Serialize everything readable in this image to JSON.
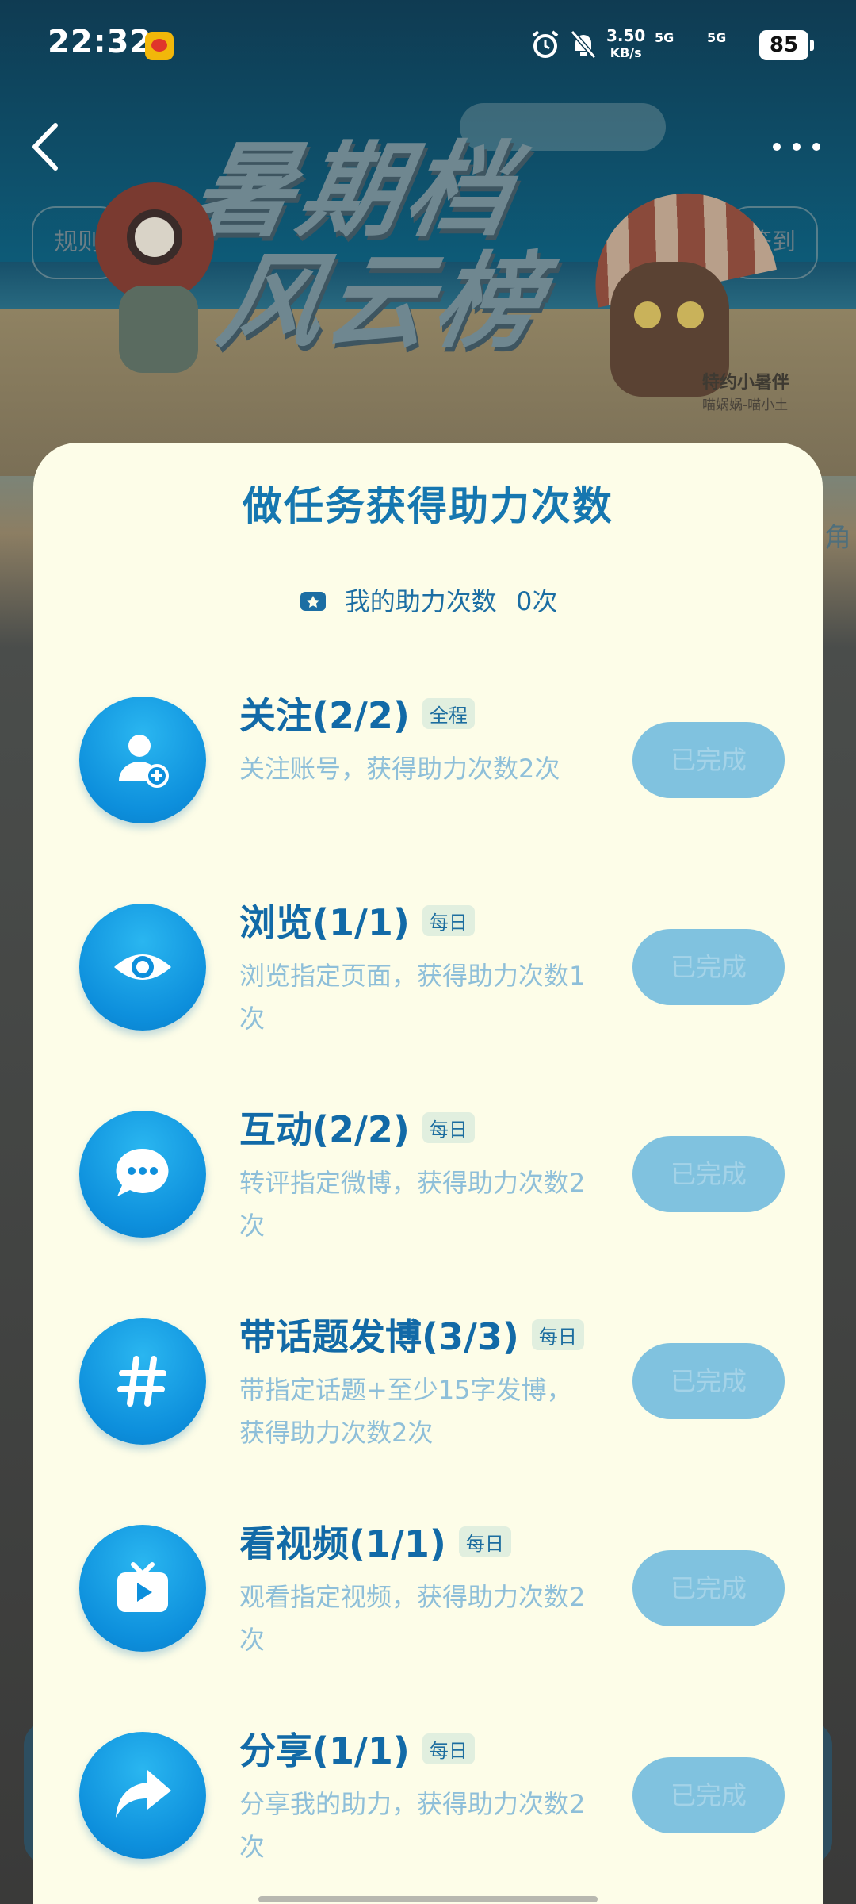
{
  "status_bar": {
    "time": "22:32",
    "net_speed": "3.50",
    "net_unit": "KB/s",
    "signal_1": "5G",
    "signal_2": "5G",
    "battery": "85"
  },
  "background": {
    "title_line1": "暑期档",
    "title_line2": "风云榜",
    "rules_label": "规则",
    "checkin_label": "签到",
    "partner_title": "特约小暑伴",
    "partner_names": "喵娲娲-喵小土",
    "side_char": "角"
  },
  "sheet": {
    "title": "做任务获得助力次数",
    "my_count_label": "我的助力次数",
    "my_count_value": "0次"
  },
  "tasks": [
    {
      "name": "关注(2/2)",
      "tag": "全程",
      "desc": "关注账号，获得助力次数2次",
      "button": "已完成",
      "icon": "follow-user-icon"
    },
    {
      "name": "浏览(1/1)",
      "tag": "每日",
      "desc": "浏览指定页面，获得助力次数1次",
      "button": "已完成",
      "icon": "eye-icon"
    },
    {
      "name": "互动(2/2)",
      "tag": "每日",
      "desc": "转评指定微博，获得助力次数2次",
      "button": "已完成",
      "icon": "chat-bubble-icon"
    },
    {
      "name": "带话题发博(3/3)",
      "tag": "每日",
      "desc": "带指定话题+至少15字发博，获得助力次数2次",
      "button": "已完成",
      "icon": "hashtag-icon"
    },
    {
      "name": "看视频(1/1)",
      "tag": "每日",
      "desc": "观看指定视频，获得助力次数2次",
      "button": "已完成",
      "icon": "video-tv-icon"
    },
    {
      "name": "分享(1/1)",
      "tag": "每日",
      "desc": "分享我的助力，获得助力次数2次",
      "button": "已完成",
      "icon": "share-arrow-icon"
    }
  ],
  "colors": {
    "sheet_bg": "#fdfde8",
    "title": "#1677b0",
    "icon_circle": "#0d8fdc",
    "done_button": "#80c2df",
    "desc_text": "#8ebfd9"
  }
}
